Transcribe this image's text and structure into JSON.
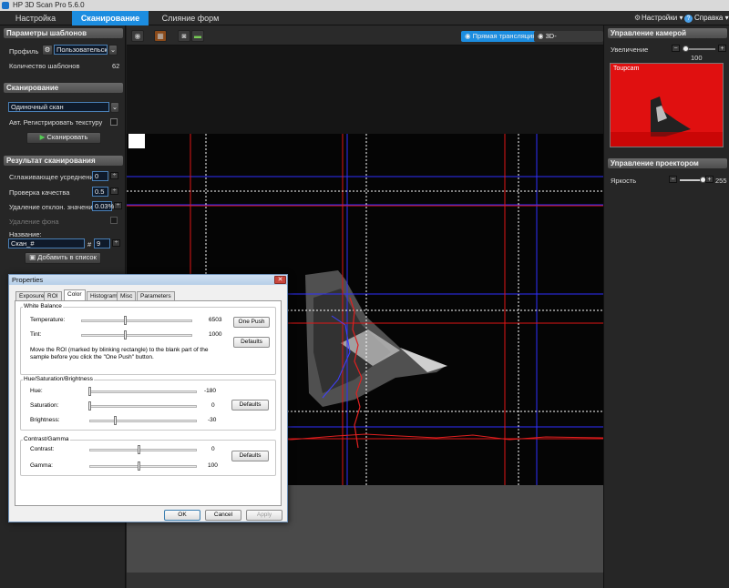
{
  "app": {
    "title": "HP 3D Scan Pro 5.6.0"
  },
  "tabs": [
    {
      "label": "Настройка"
    },
    {
      "label": "Сканирование"
    },
    {
      "label": "Слияние форм"
    }
  ],
  "top_menu": {
    "settings": "Настройки",
    "help": "Справка"
  },
  "template_params": {
    "header": "Параметры шаблонов",
    "profile_label": "Профиль",
    "profile_value": "Пользовательские",
    "count_label": "Количество шаблонов",
    "count_value": "62"
  },
  "scanning": {
    "header": "Сканирование",
    "mode_value": "Одиночный скан",
    "auto_texture_label": "Авт. Регистрировать текстуру",
    "scan_button": "Сканировать"
  },
  "scan_result": {
    "header": "Результат сканирования",
    "smoothing_label": "Сглаживающее усреднение",
    "smoothing_value": "0",
    "quality_label": "Проверка качества",
    "quality_value": "0.5",
    "outlier_label": "Удаление отклон. значений",
    "outlier_value": "0.03%",
    "bg_removal_label": "Удаление фона",
    "name_label": "Название:",
    "name_value": "Скан_#",
    "index_prefix": "#",
    "index_value": "9",
    "add_button": "Добавить в список"
  },
  "toolbar": {
    "live_label": "Прямая трансляция",
    "scan3d_label": "3D-сканирование"
  },
  "camera": {
    "header": "Управление камерой",
    "zoom_label": "Увеличение",
    "zoom_value": "100",
    "zoom_level": 0.1,
    "preview_label": "Toupcam"
  },
  "projector": {
    "header": "Управление проектором",
    "brightness_label": "Яркость",
    "brightness_value": "255",
    "brightness_level": 1.0
  },
  "properties": {
    "title": "Properties",
    "tabs": [
      "Exposure",
      "ROI",
      "Color",
      "Histogram",
      "Misc",
      "Parameters"
    ],
    "white_balance": {
      "group": "White Balance",
      "temperature_label": "Temperature:",
      "temperature_value": "6503",
      "tint_label": "Tint:",
      "tint_value": "1000",
      "note": "Move the ROI (marked by blinking rectangle) to the blank part of the sample before you click the \"One Push\" button.",
      "one_push": "One Push",
      "defaults": "Defaults"
    },
    "hsb": {
      "group": "Hue/Saturation/Brightness",
      "hue_label": "Hue:",
      "hue_value": "-180",
      "saturation_label": "Saturation:",
      "saturation_value": "0",
      "brightness_label": "Brightness:",
      "brightness_value": "-30",
      "defaults": "Defaults"
    },
    "contrast_gamma": {
      "group": "Contrast/Gamma",
      "contrast_label": "Contrast:",
      "contrast_value": "0",
      "gamma_label": "Gamma:",
      "gamma_value": "100",
      "defaults": "Defaults"
    },
    "ok": "OK",
    "cancel": "Cancel",
    "apply": "Apply"
  },
  "colors": {
    "accent": "#1c8de0",
    "preview_bg": "#e01010"
  }
}
